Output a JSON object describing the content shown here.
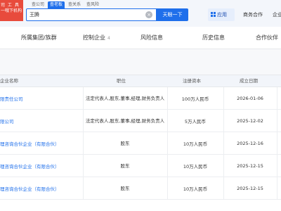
{
  "header": {
    "logo_line1": "司 工 具",
    "logo_line2": "一哦下机构",
    "search_tabs": [
      {
        "label": "查公司",
        "active": false
      },
      {
        "label": "查老板",
        "active": true
      },
      {
        "label": "查关系",
        "active": false
      },
      {
        "label": "查风险",
        "active": false
      }
    ],
    "search_value": "王腾",
    "search_button": "天眼一下",
    "app_label": "应用",
    "nav_links": [
      "商务合作",
      "企业"
    ]
  },
  "tabs": [
    {
      "label": "所属集团/族群",
      "count": ""
    },
    {
      "label": "控制企业",
      "count": "4"
    },
    {
      "label": "风险信息",
      "count": ""
    },
    {
      "label": "历史信息",
      "count": ""
    },
    {
      "label": "合作伙伴",
      "count": ""
    }
  ],
  "table": {
    "headers": [
      "企业名称",
      "职位",
      "注册资本",
      "成立日期"
    ],
    "rows": [
      {
        "name": "限责任公司",
        "role": "法定代表人,股东,董事,经理,财务负责人",
        "capital": "100万人民币",
        "date": "2026-01-06"
      },
      {
        "name": "限公司",
        "role": "法定代表人,股东,董事,经理,财务负责人",
        "capital": "5万人民币",
        "date": "2025-12-02"
      },
      {
        "name": "理咨询合伙企业（有限合伙）",
        "role": "股东",
        "capital": "10万人民币",
        "date": "2025-12-16"
      },
      {
        "name": "理咨询合伙企业（有限合伙）",
        "role": "股东",
        "capital": "10万人民币",
        "date": "2025-12-15"
      },
      {
        "name": "理咨询合伙企业（有限合伙）",
        "role": "股东",
        "capital": "10万人民币",
        "date": "2025-12-15"
      }
    ]
  },
  "colors": {
    "accent": "#1f6feb",
    "logo": "#e84b3c",
    "header_bg": "#f3f6fb",
    "table_header_bg": "#f2f5fa"
  }
}
